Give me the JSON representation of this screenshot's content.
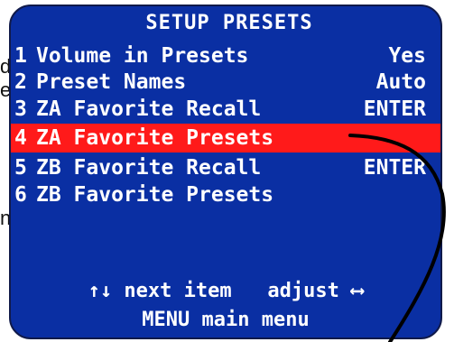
{
  "doc_fragments": [
    "d",
    "e",
    "",
    "",
    "",
    "",
    "n"
  ],
  "screen": {
    "title": "SETUP PRESETS",
    "items": [
      {
        "num": "1",
        "label": "Volume in Presets",
        "value": "Yes",
        "selected": false
      },
      {
        "num": "2",
        "label": "Preset Names",
        "value": "Auto",
        "selected": false
      },
      {
        "num": "3",
        "label": "ZA Favorite Recall",
        "value": "ENTER",
        "selected": false
      },
      {
        "num": "4",
        "label": "ZA Favorite Presets",
        "value": "",
        "selected": true
      },
      {
        "num": "5",
        "label": "ZB Favorite Recall",
        "value": "ENTER",
        "selected": false
      },
      {
        "num": "6",
        "label": "ZB Favorite Presets",
        "value": "",
        "selected": false
      }
    ],
    "nav_hint": "↑↓ next item   adjust ⟷",
    "menu_hint": "MENU main menu"
  },
  "colors": {
    "panel_bg": "#0a2fa3",
    "highlight": "#ff1a1a",
    "text": "#ffffff",
    "leader_line": "#000000"
  }
}
